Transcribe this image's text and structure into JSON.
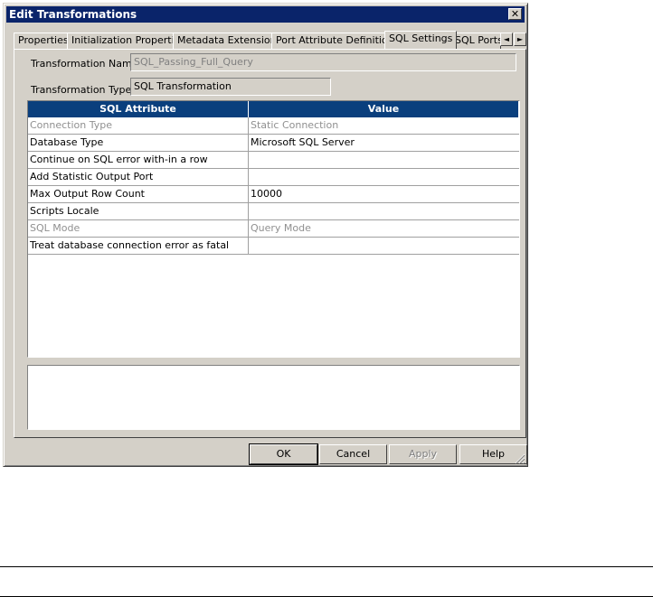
{
  "window": {
    "title": "Edit Transformations",
    "close_glyph": "✕"
  },
  "tabs": [
    {
      "label": "Properties"
    },
    {
      "label": "Initialization Properties"
    },
    {
      "label": "Metadata Extensions"
    },
    {
      "label": "Port Attribute Definitions"
    },
    {
      "label": "SQL Settings"
    },
    {
      "label": "SQL Ports"
    }
  ],
  "active_tab": "SQL Settings",
  "tab_scroll": {
    "left": "◄",
    "right": "►"
  },
  "form": {
    "name_label": "Transformation Name:",
    "name_value": "SQL_Passing_Full_Query",
    "type_label": "Transformation Type:",
    "type_value": "SQL Transformation"
  },
  "grid": {
    "columns": [
      "SQL Attribute",
      "Value"
    ],
    "header_color": "#0a3f7d",
    "rows": [
      {
        "attribute": "Connection Type",
        "value": "Static Connection",
        "disabled": true
      },
      {
        "attribute": "Database Type",
        "value": "Microsoft SQL Server",
        "disabled": false
      },
      {
        "attribute": "Continue on SQL error with-in a row",
        "value": "",
        "disabled": false
      },
      {
        "attribute": "Add Statistic Output Port",
        "value": "",
        "disabled": false
      },
      {
        "attribute": "Max Output Row Count",
        "value": "10000",
        "disabled": false
      },
      {
        "attribute": "Scripts Locale",
        "value": "",
        "disabled": false
      },
      {
        "attribute": "SQL Mode",
        "value": "Query Mode",
        "disabled": true
      },
      {
        "attribute": "Treat database connection error as fatal",
        "value": "",
        "disabled": false
      }
    ]
  },
  "description": "",
  "buttons": {
    "ok": "OK",
    "cancel": "Cancel",
    "apply": "Apply",
    "help": "Help"
  }
}
